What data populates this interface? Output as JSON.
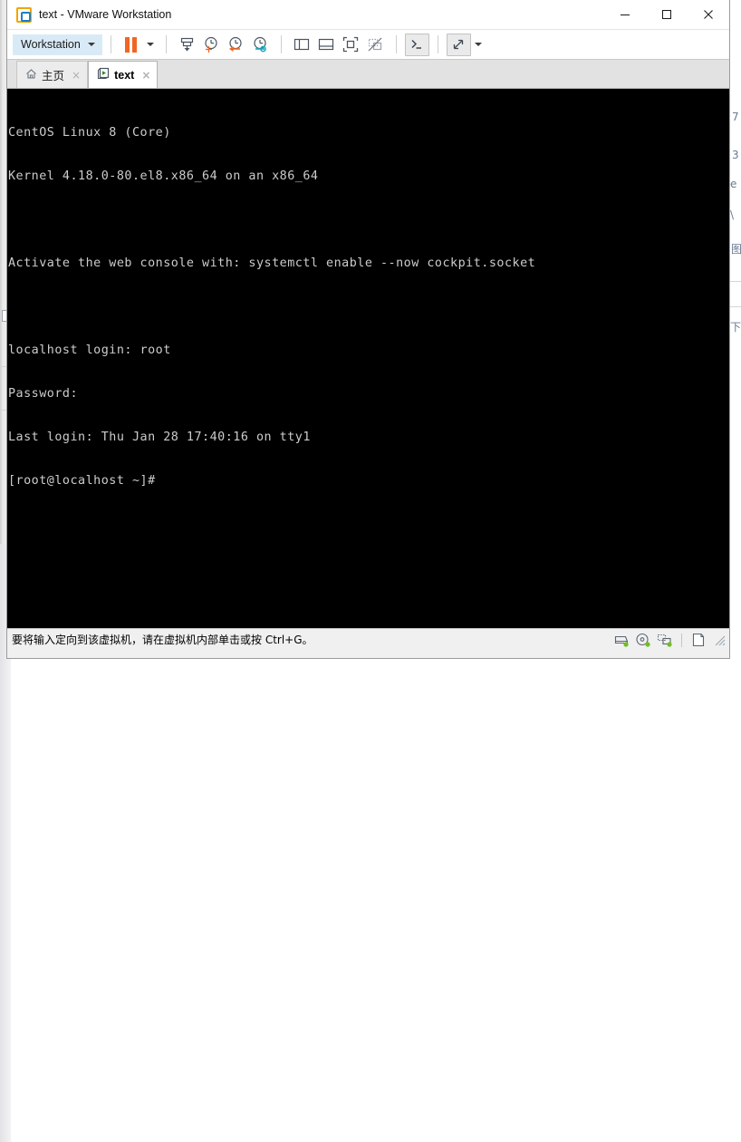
{
  "window": {
    "title": "text - VMware Workstation",
    "app_icon": "vmware-logo-icon",
    "controls": {
      "minimize": "minimize-icon",
      "maximize": "maximize-icon",
      "close": "close-icon"
    }
  },
  "toolbar": {
    "menu_label": "Workstation",
    "menu_caret": "chevron-down-icon",
    "items": [
      {
        "name": "pause-button",
        "icon": "pause-icon",
        "label": "Pause"
      },
      {
        "name": "pause-dropdown",
        "icon": "chevron-down-icon",
        "label": "Pause options"
      },
      {
        "name": "snapshot-button",
        "icon": "take-snapshot-icon",
        "label": "Take snapshot"
      },
      {
        "name": "snapshot-manager-button",
        "icon": "snapshot-add-icon",
        "label": "Manage snapshots"
      },
      {
        "name": "revert-snapshot-button",
        "icon": "snapshot-revert-icon",
        "label": "Revert to snapshot"
      },
      {
        "name": "snapshot-settings-button",
        "icon": "snapshot-settings-icon",
        "label": "Snapshot settings"
      },
      {
        "name": "show-library-button",
        "icon": "library-pane-icon",
        "label": "Show or hide the library"
      },
      {
        "name": "show-thumbnail-button",
        "icon": "thumbnail-pane-icon",
        "label": "Show or hide thumbnails"
      },
      {
        "name": "fullscreen-button",
        "icon": "fullscreen-icon",
        "label": "Enter full screen"
      },
      {
        "name": "unity-button",
        "icon": "unity-mode-icon",
        "label": "Unity mode"
      },
      {
        "name": "console-button",
        "icon": "terminal-prompt-icon",
        "label": "Console view"
      },
      {
        "name": "stretch-button",
        "icon": "stretch-arrows-icon",
        "label": "Stretch guest"
      },
      {
        "name": "stretch-dropdown",
        "icon": "chevron-down-icon",
        "label": "Stretch options"
      }
    ]
  },
  "tabs": [
    {
      "label": "主页",
      "icon": "home-icon",
      "close": "×",
      "active": false
    },
    {
      "label": "text",
      "icon": "virtual-machine-icon",
      "close": "×",
      "active": true
    }
  ],
  "terminal": {
    "lines": [
      "CentOS Linux 8 (Core)",
      "Kernel 4.18.0-80.el8.x86_64 on an x86_64",
      "",
      "Activate the web console with: systemctl enable --now cockpit.socket",
      "",
      "localhost login: root",
      "Password:",
      "Last login: Thu Jan 28 17:40:16 on tty1",
      "[root@localhost ~]#"
    ],
    "foreground_color": "#cccccc",
    "background_color": "#000000"
  },
  "status_bar": {
    "message": "要将输入定向到该虚拟机，请在虚拟机内部单击或按 Ctrl+G。",
    "devices": [
      {
        "name": "hard-disk-icon",
        "label": "Hard Disk",
        "indicator_color": "#6dbf22"
      },
      {
        "name": "cd-dvd-icon",
        "label": "CD/DVD",
        "indicator_color": "#6dbf22"
      },
      {
        "name": "network-adapter-icon",
        "label": "Network Adapter",
        "indicator_color": "#6dbf22"
      }
    ],
    "note_icon": "note-icon",
    "resize_grip": "resize-grip-icon"
  },
  "background_window": {
    "left_fragments": [
      "",
      "",
      ""
    ],
    "right_fragments": [
      "7",
      "3",
      "e",
      "\\",
      "图",
      "下"
    ]
  },
  "colors": {
    "accent_orange": "#f26522",
    "accent_blue": "#1f7fc4",
    "menu_highlight": "#d9eaf7",
    "toolbar_bg": "#ffffff",
    "tabbar_bg": "#e2e2e2",
    "statusbar_bg": "#f0f0f0",
    "vm_black": "#000000"
  }
}
